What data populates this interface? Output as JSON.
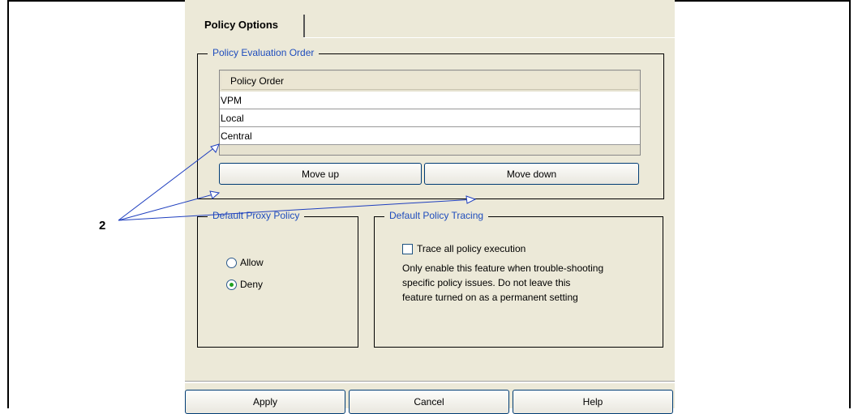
{
  "tab": {
    "label": "Policy Options"
  },
  "evaluation_group": {
    "legend": "Policy Evaluation Order",
    "list_header": "Policy Order",
    "items": [
      "VPM",
      "Local",
      "Central"
    ],
    "move_up_label": "Move up",
    "move_down_label": "Move down"
  },
  "proxy_group": {
    "legend": "Default Proxy Policy",
    "options": [
      {
        "label": "Allow",
        "selected": false
      },
      {
        "label": "Deny",
        "selected": true
      }
    ]
  },
  "tracing_group": {
    "legend": "Default Policy Tracing",
    "checkbox_label": "Trace all policy execution",
    "checked": false,
    "note_lines": [
      "Only enable this feature when trouble-shooting",
      "specific policy issues.  Do not leave this",
      "feature turned on as a permanent setting"
    ]
  },
  "buttons": {
    "apply": "Apply",
    "cancel": "Cancel",
    "help": "Help"
  },
  "callout": {
    "label": "2"
  }
}
